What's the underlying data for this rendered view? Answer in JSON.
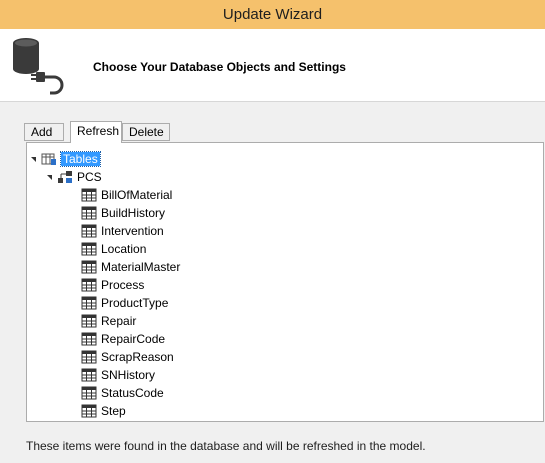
{
  "window": {
    "title": "Update Wizard"
  },
  "header": {
    "title": "Choose Your Database Objects and Settings",
    "icon": "database-plug-icon"
  },
  "tabs": [
    {
      "label": "Add",
      "active": false
    },
    {
      "label": "Refresh",
      "active": true
    },
    {
      "label": "Delete",
      "active": false
    }
  ],
  "tree": {
    "root": {
      "label": "Tables",
      "expanded": true,
      "selected": true
    },
    "schema": {
      "label": "PCS",
      "expanded": true
    },
    "tables": [
      "BillOfMaterial",
      "BuildHistory",
      "Intervention",
      "Location",
      "MaterialMaster",
      "Process",
      "ProductType",
      "Repair",
      "RepairCode",
      "ScrapReason",
      "SNHistory",
      "StatusCode",
      "Step"
    ]
  },
  "footer": {
    "text": "These items were found in the database and will be refreshed in the model."
  },
  "colors": {
    "titlebar": "#f5c16c",
    "selection": "#3399ff"
  }
}
